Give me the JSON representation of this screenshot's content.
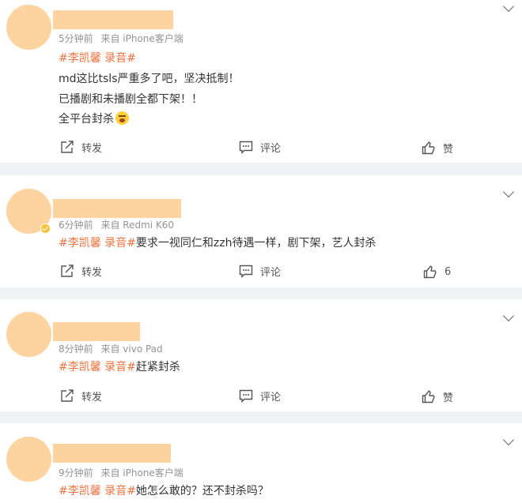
{
  "comments": [
    {
      "time": "5分钟前",
      "source": "来自 iPhone客户端",
      "tag": "#李凯馨 录音#",
      "lines": [
        "md这比tsls严重多了吧，坚决抵制！",
        "已播剧和未播剧全都下架！！",
        "全平台封杀"
      ],
      "emoji": "scream-emoji",
      "like_label": "赞"
    },
    {
      "time": "6分钟前",
      "source": "来自 Redmi K60",
      "tag": "#李凯馨 录音#",
      "text": "要求一视同仁和zzh待遇一样，剧下架，艺人封杀",
      "like_label": "6"
    },
    {
      "time": "8分钟前",
      "source": "来自 vivo Pad",
      "tag": "#李凯馨 录音#",
      "text": "赶紧封杀",
      "like_label": "赞"
    },
    {
      "time": "9分钟前",
      "source": "来自 iPhone客户端",
      "tag": "#李凯馨 录音#",
      "text": "她怎么敢的？还不封杀吗？"
    }
  ],
  "actions": {
    "repost": "转发",
    "comment": "评论"
  },
  "icons": [
    "chevron-down-icon",
    "repost-icon",
    "comment-icon",
    "like-icon",
    "verified-badge-icon"
  ],
  "colors": {
    "tag": "#eb7340",
    "avatar": "#fdd39f",
    "meta": "#939393"
  }
}
